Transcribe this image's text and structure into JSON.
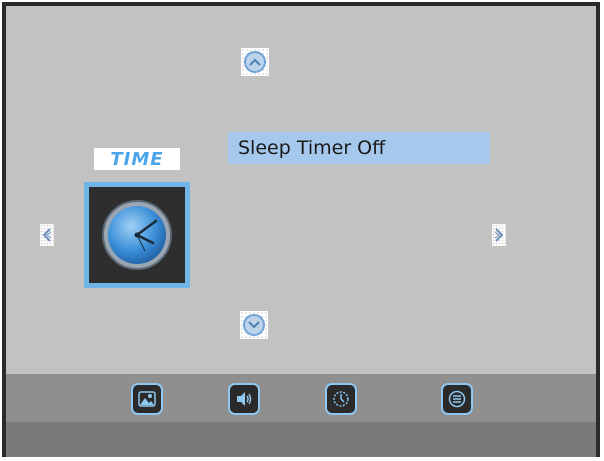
{
  "window": {
    "title": ""
  },
  "category": {
    "label": "TIME",
    "icon": "clock-icon"
  },
  "menu": {
    "selected_item": "Sleep Timer Off"
  },
  "navigation": {
    "up_icon": "chevron-up-icon",
    "down_icon": "chevron-down-icon",
    "left_icon": "chevron-left-icon",
    "right_icon": "chevron-right-icon"
  },
  "tabs": [
    {
      "name": "picture",
      "icon": "picture-icon"
    },
    {
      "name": "sound",
      "icon": "speaker-icon"
    },
    {
      "name": "time",
      "icon": "clock-icon"
    },
    {
      "name": "menu",
      "icon": "list-icon"
    }
  ],
  "colors": {
    "background": "#c2c2c2",
    "highlight": "#a6c8ec",
    "accent": "#4aa6e8",
    "bottom_bar": "#8f8f8f",
    "border": "#2a2a2a"
  }
}
